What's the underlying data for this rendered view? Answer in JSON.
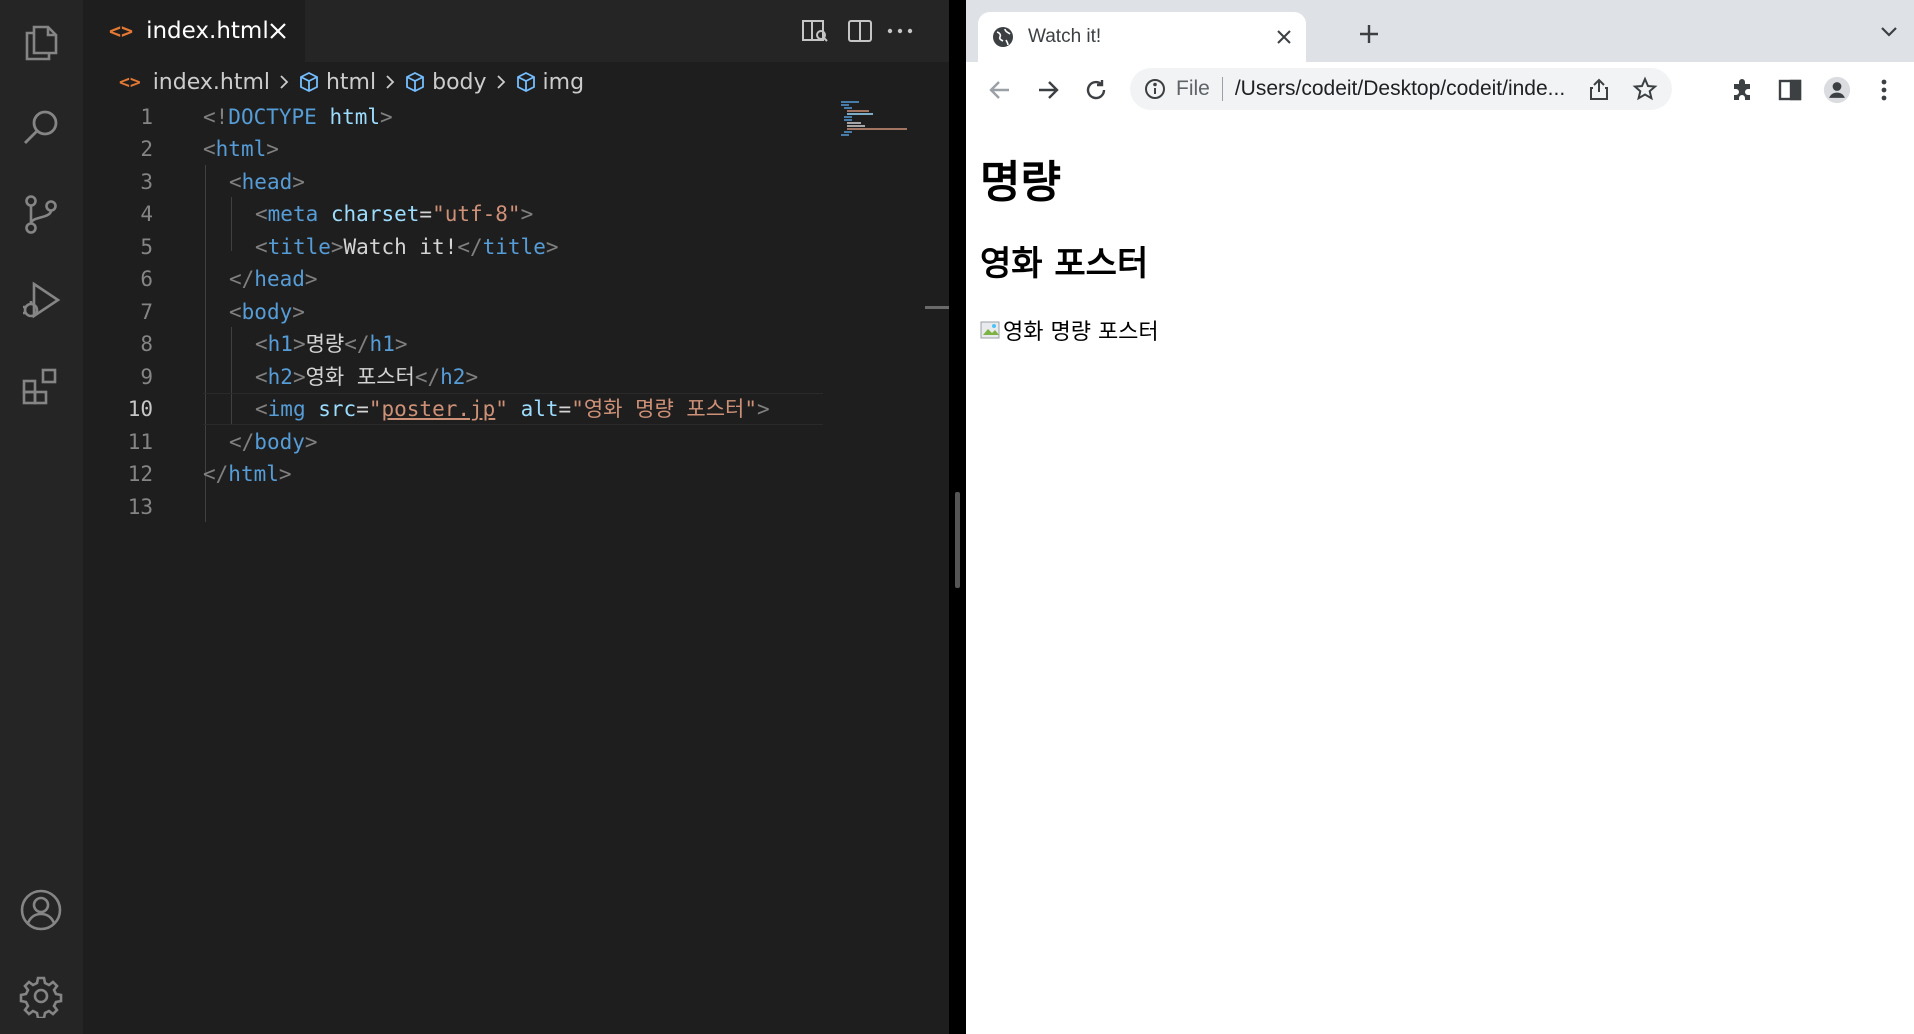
{
  "editor": {
    "tab": {
      "icon": "<>",
      "name": "index.html"
    },
    "breadcrumb": [
      "index.html",
      "html",
      "body",
      "img"
    ],
    "line_numbers": [
      "1",
      "2",
      "3",
      "4",
      "5",
      "6",
      "7",
      "8",
      "9",
      "10",
      "11",
      "12",
      "13"
    ],
    "active_line": "10",
    "code": {
      "l1": {
        "open": "<!",
        "doctype": "DOCTYPE",
        "sp": " ",
        "html": "html",
        "close": ">"
      },
      "l2": {
        "open": "<",
        "tag": "html",
        "close": ">"
      },
      "l3": {
        "open": "<",
        "tag": "head",
        "close": ">"
      },
      "l4": {
        "open": "<",
        "tag": "meta",
        "sp": " ",
        "attr": "charset",
        "eq": "=",
        "val": "\"utf-8\"",
        "close": ">"
      },
      "l5": {
        "open": "<",
        "tag": "title",
        "close": ">",
        "text": "Watch it!",
        "open2": "</",
        "tag2": "title",
        "close2": ">"
      },
      "l6": {
        "open": "</",
        "tag": "head",
        "close": ">"
      },
      "l7": {
        "open": "<",
        "tag": "body",
        "close": ">"
      },
      "l8": {
        "open": "<",
        "tag": "h1",
        "close": ">",
        "text": "명량",
        "open2": "</",
        "tag2": "h1",
        "close2": ">"
      },
      "l9": {
        "open": "<",
        "tag": "h2",
        "close": ">",
        "text": "영화 포스터",
        "open2": "</",
        "tag2": "h2",
        "close2": ">"
      },
      "l10": {
        "open": "<",
        "tag": "img",
        "sp": " ",
        "attr1": "src",
        "eq1": "=",
        "q1": "\"",
        "src": "poster.jp",
        "q2": "\"",
        "sp2": " ",
        "attr2": "alt",
        "eq2": "=",
        "alt": "\"영화 명량 포스터\"",
        "close": ">"
      },
      "l11": {
        "open": "</",
        "tag": "body",
        "close": ">"
      },
      "l12": {
        "open": "</",
        "tag": "html",
        "close": ">"
      }
    }
  },
  "browser": {
    "tab_title": "Watch it!",
    "omnibox": {
      "scheme_label": "File",
      "url": "/Users/codeit/Desktop/codeit/inde..."
    },
    "page": {
      "h1": "명량",
      "h2": "영화 포스터",
      "img_alt": "영화 명량 포스터"
    }
  },
  "colors": {
    "tag": "#569cd6",
    "attr": "#9cdcfe",
    "string": "#ce9178",
    "punct": "#808080",
    "tab_icon": "#e37933"
  }
}
